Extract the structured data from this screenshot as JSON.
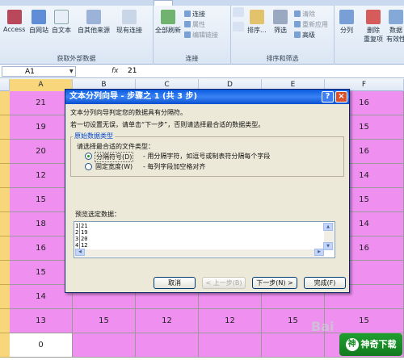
{
  "ribbon": {
    "get_external": {
      "access": "Access",
      "web": "自网站",
      "text": "自文本",
      "other": "自其他来源",
      "existing": "现有连接",
      "title": "获取外部数据"
    },
    "connections": {
      "refresh_all": "全部刷新",
      "connections": "连接",
      "properties": "属性",
      "edit_links": "编辑链接",
      "title": "连接"
    },
    "sort_filter": {
      "sort": "排序...",
      "filter": "筛选",
      "clear": "清除",
      "reapply": "重新应用",
      "advanced": "高级",
      "title": "排序和筛选"
    },
    "data_tools": {
      "split": "分列",
      "remove_dup": "删除",
      "remove_dup2": "重复项",
      "validation": "数据",
      "validation2": "有效性"
    }
  },
  "formula_bar": {
    "cell_ref": "A1",
    "fx": "fx",
    "value": "21"
  },
  "columns": [
    "A",
    "B",
    "C",
    "D",
    "E",
    "F"
  ],
  "grid": {
    "col_a": [
      "21",
      "19",
      "20",
      "12",
      "15",
      "18",
      "16",
      "15",
      "14",
      "13",
      "0"
    ],
    "col_f_top": [
      "16",
      "15",
      "16",
      "14",
      "15",
      "14",
      "16"
    ],
    "row13": [
      "15",
      "12",
      "12",
      "15",
      "15"
    ]
  },
  "dialog": {
    "title": "文本分列向导 - 步骤之 1 (共 3 步)",
    "help": "?",
    "close": "×",
    "line1": "文本分列向导判定您的数据具有分隔符。",
    "line2": "若一切设置无误，请单击“下一步”，否则请选择最合适的数据类型。",
    "legend": "原始数据类型",
    "prompt": "请选择最合适的文件类型：",
    "opt1_label": "分隔符号(D)",
    "opt1_desc": "- 用分隔字符，如逗号或制表符分隔每个字段",
    "opt2_label": "固定宽度(W)",
    "opt2_desc": "- 每列字段加空格对齐",
    "preview_label": "预览选定数据：",
    "preview_rows": [
      {
        "n": "1",
        "v": "21"
      },
      {
        "n": "2",
        "v": "19"
      },
      {
        "n": "3",
        "v": "20"
      },
      {
        "n": "4",
        "v": "12"
      }
    ],
    "btn_cancel": "取消",
    "btn_back": "< 上一步(B)",
    "btn_next": "下一步(N) >",
    "btn_finish": "完成(F)"
  },
  "watermark": "Bai",
  "logo": {
    "mark": "神",
    "text": "神奇下载"
  },
  "colors": {
    "pink": "#ef8ff0",
    "accent": "#0a5be0",
    "row_header": "#f8d77c"
  }
}
